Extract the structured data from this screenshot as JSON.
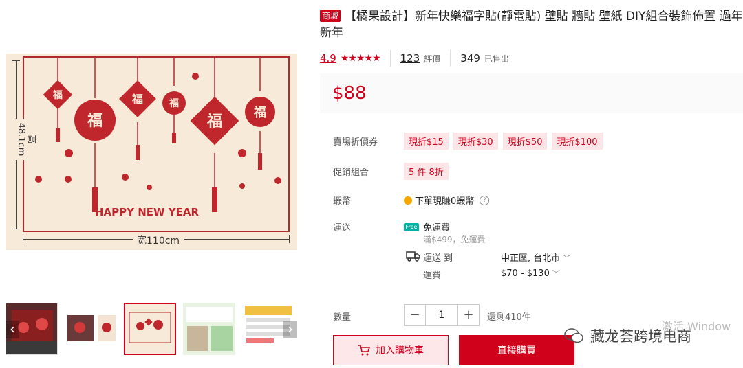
{
  "product": {
    "tag": "商城",
    "title": "【橘果設計】新年快樂福字貼(靜電貼) 壁貼 牆貼 壁紙 DIY組合裝飾佈置 過年新年",
    "rating": "4.9",
    "stars": "★★★★★",
    "reviews_count": "123",
    "reviews_label": "評價",
    "sold_count": "349",
    "sold_label": "已售出",
    "price": "$88"
  },
  "image": {
    "height_label": "高48.1cm",
    "width_label": "宽110cm",
    "caption": "HAPPY NEW YEAR",
    "fu_char": "福"
  },
  "details": {
    "voucher_label": "賣場折價券",
    "vouchers": [
      "現折$15",
      "現折$30",
      "現折$50",
      "現折$100"
    ],
    "combo_label": "促銷組合",
    "combo_value": "5 件 8折",
    "coins_label": "蝦幣",
    "coins_text": "下單現賺0蝦幣",
    "shipping_label": "運送",
    "free_badge": "Free",
    "free_shipping": "免運費",
    "free_condition": "滿$499，免運費",
    "ship_to_label": "運送 到",
    "ship_to_value": "中正區, 台北市",
    "fee_label": "運費",
    "fee_value": "$70 - $130",
    "qty_label": "數量",
    "qty_minus": "−",
    "qty_value": "1",
    "qty_plus": "+",
    "stock": "還剩410件",
    "add_to_cart": "加入購物車",
    "buy_now": "直接購買"
  },
  "overlay": {
    "watermark": "藏龙荟跨境电商",
    "activate": "激活 Window"
  },
  "colors": {
    "accent": "#d0011b",
    "image_bg": "#f8ead8"
  }
}
